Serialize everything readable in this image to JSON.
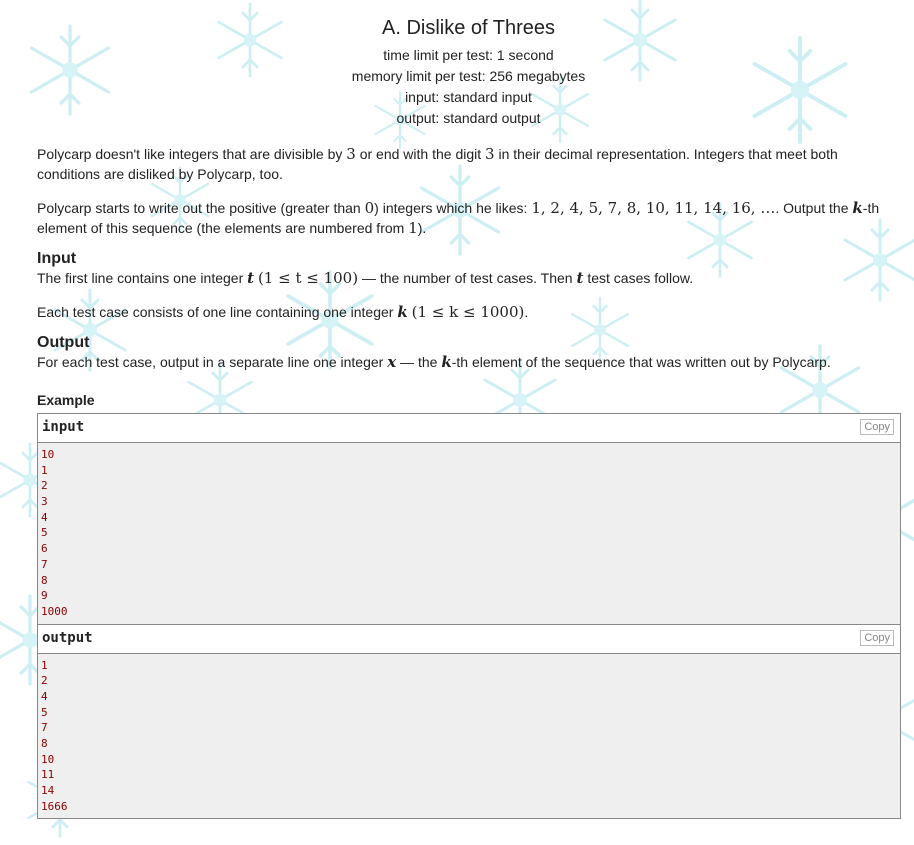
{
  "problem": {
    "title": "A. Dislike of Threes",
    "time_limit": "time limit per test: 1 second",
    "memory_limit": "memory limit per test: 256 megabytes",
    "input_type": "input: standard input",
    "output_type": "output: standard output"
  },
  "statement": {
    "p1_a": "Polycarp doesn't like integers that are divisible by ",
    "p1_m1": "3",
    "p1_b": " or end with the digit ",
    "p1_m2": "3",
    "p1_c": " in their decimal representation. Integers that meet both conditions are disliked by Polycarp, too.",
    "p2_a": "Polycarp starts to write out the positive (greater than ",
    "p2_m1": "0",
    "p2_b": ") integers which he likes: ",
    "p2_m2": "1, 2, 4, 5, 7, 8, 10, 11, 14, 16, …",
    "p2_c": ". Output the ",
    "p2_k": "k",
    "p2_d": "-th element of this sequence (the elements are numbered from ",
    "p2_m3": "1",
    "p2_e": ")."
  },
  "input_section": {
    "title": "Input",
    "p1_a": "The first line contains one integer ",
    "p1_t": "t",
    "p1_m": "(1 ≤ t ≤ 100)",
    "p1_b": " — the number of test cases. Then ",
    "p1_t2": "t",
    "p1_c": " test cases follow.",
    "p2_a": "Each test case consists of one line containing one integer ",
    "p2_k": "k",
    "p2_m": "(1 ≤ k ≤ 1000)",
    "p2_b": "."
  },
  "output_section": {
    "title": "Output",
    "p1_a": "For each test case, output in a separate line one integer ",
    "p1_x": "x",
    "p1_b": " — the ",
    "p1_k": "k",
    "p1_c": "-th element of the sequence that was written out by Polycarp."
  },
  "example": {
    "title": "Example",
    "input_label": "input",
    "output_label": "output",
    "copy_label": "Copy",
    "input_lines": [
      "10",
      "1",
      "2",
      "3",
      "4",
      "5",
      "6",
      "7",
      "8",
      "9",
      "1000"
    ],
    "output_lines": [
      "1",
      "2",
      "4",
      "5",
      "7",
      "8",
      "10",
      "11",
      "14",
      "1666"
    ]
  }
}
